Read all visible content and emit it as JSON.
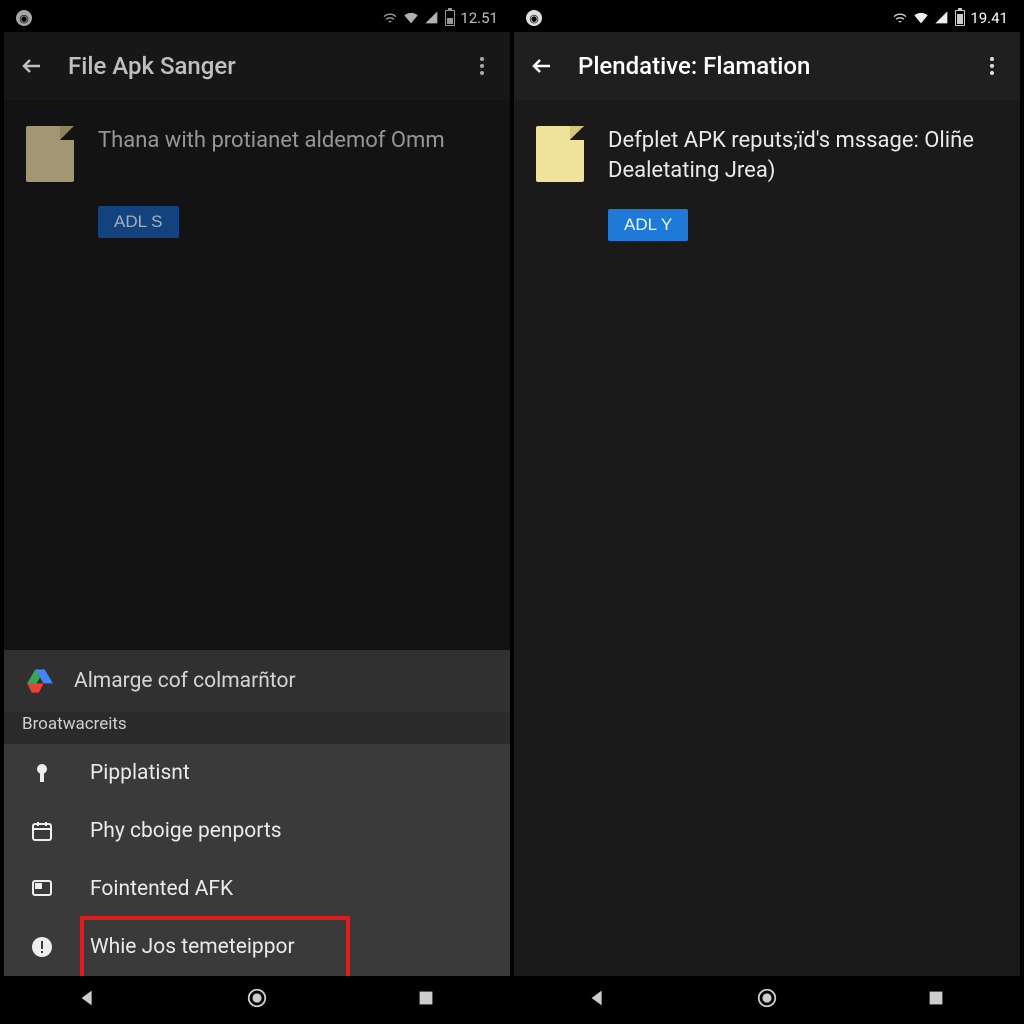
{
  "left": {
    "status": {
      "time": "12.51"
    },
    "header": {
      "title": "File Apk Sanger"
    },
    "file": {
      "text": "Thana with protianet aldemof Omm",
      "button": "ADL S"
    },
    "sheet": {
      "header": "Almarge cof colmarñtor",
      "section": "Broatwacreits",
      "items": [
        {
          "label": "Pipplatisnt",
          "icon": "pin"
        },
        {
          "label": "Phy cboige penports",
          "icon": "calendar"
        },
        {
          "label": "Fointented AFK",
          "icon": "square"
        },
        {
          "label": "Whie Jos temeteippor",
          "icon": "alert",
          "highlight": true
        }
      ]
    }
  },
  "right": {
    "status": {
      "time": "19.41"
    },
    "header": {
      "title": "Plendative: Flamation"
    },
    "file": {
      "text": "Defplet APK reputs;ïd's mssage: Oliñe Dealetating Jrea)",
      "button": "ADL Y"
    }
  }
}
